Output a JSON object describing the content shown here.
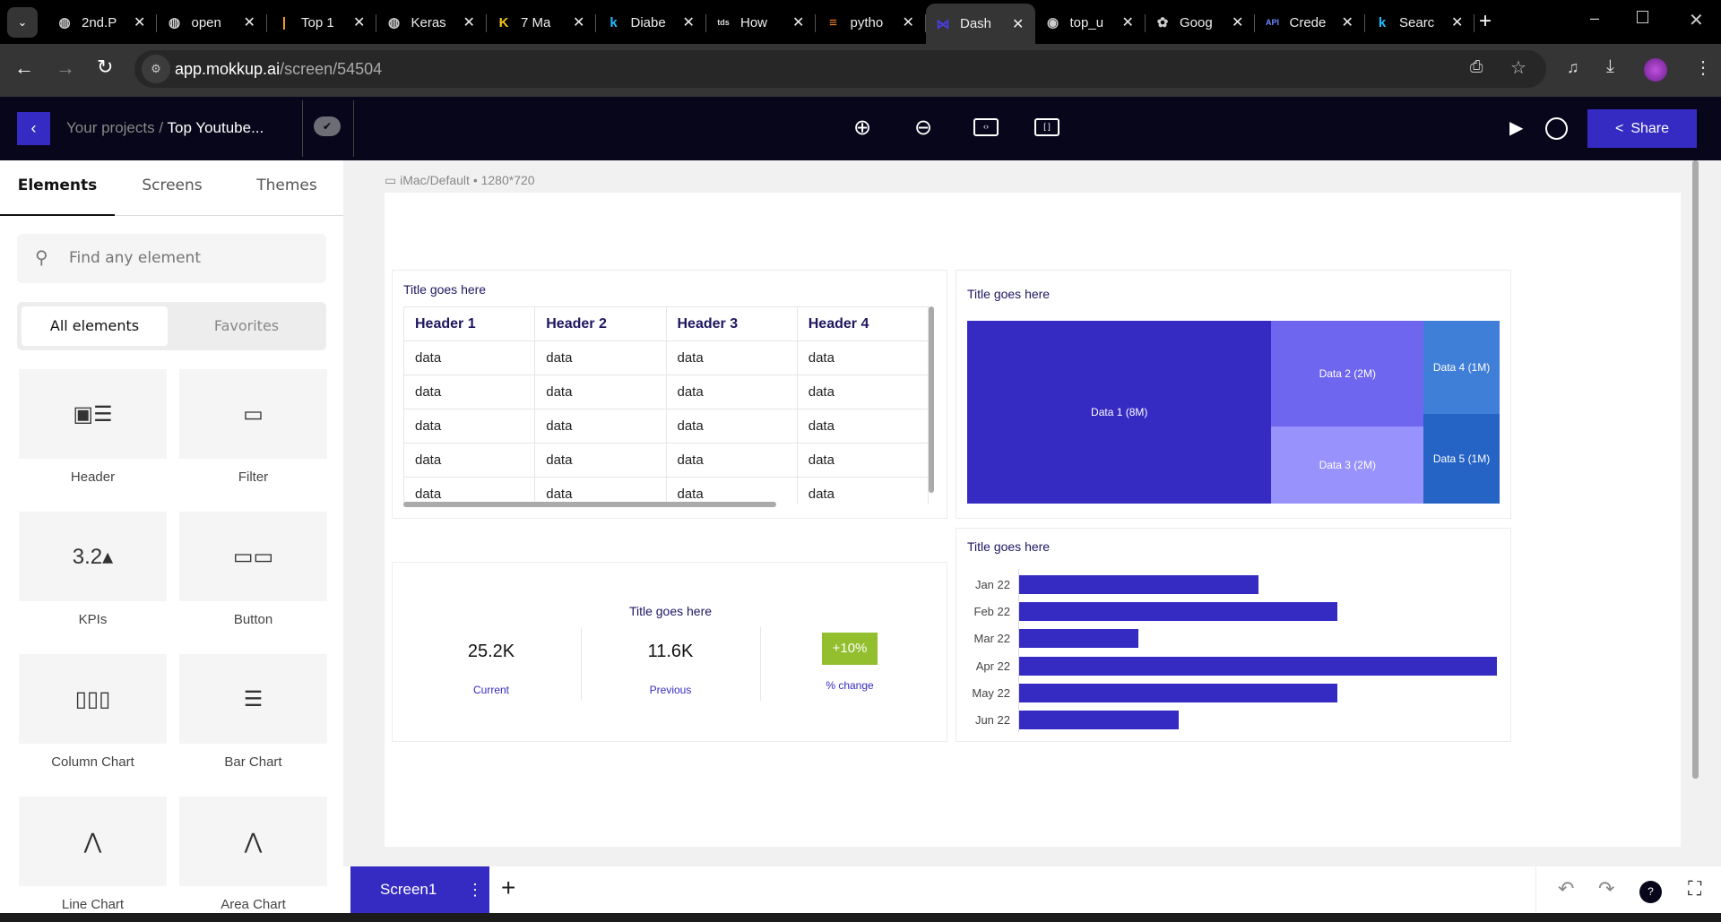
{
  "browser": {
    "tabs": [
      {
        "title": "2nd.P",
        "icon": "globe-icon"
      },
      {
        "title": "open",
        "icon": "globe-icon"
      },
      {
        "title": "Top 1",
        "icon": "bars-icon"
      },
      {
        "title": "Keras",
        "icon": "globe-icon"
      },
      {
        "title": "7 Ma",
        "icon": "k-icon"
      },
      {
        "title": "Diabe",
        "icon": "kaggle-icon"
      },
      {
        "title": "How",
        "icon": "tds-icon"
      },
      {
        "title": "pytho",
        "icon": "stackoverflow-icon"
      },
      {
        "title": "Dash",
        "icon": "mokkup-icon",
        "active": true
      },
      {
        "title": "top_u",
        "icon": "github-icon"
      },
      {
        "title": "Goog",
        "icon": "openai-icon"
      },
      {
        "title": "Crede",
        "icon": "api-icon"
      },
      {
        "title": "Searc",
        "icon": "kaggle-icon"
      }
    ],
    "url_host": "app.mokkup.ai",
    "url_path": "/screen/54504"
  },
  "header": {
    "breadcrumb_root": "Your projects",
    "breadcrumb_sep": " / ",
    "project": "Top Youtube...",
    "share_label": "Share",
    "accent": "#352bc2"
  },
  "sidebar": {
    "tabs": [
      "Elements",
      "Screens",
      "Themes"
    ],
    "search_placeholder": "Find any element",
    "filters": [
      "All elements",
      "Favorites"
    ],
    "elements": [
      "Header",
      "Filter",
      "KPIs",
      "Button",
      "Column Chart",
      "Bar Chart",
      "Line Chart",
      "Area Chart"
    ]
  },
  "canvas": {
    "device_label": "iMac/Default • 1280*720"
  },
  "table_card": {
    "title": "Title goes here",
    "headers": [
      "Header 1",
      "Header 2",
      "Header 3",
      "Header 4"
    ],
    "rows": [
      [
        "data",
        "data",
        "data",
        "data"
      ],
      [
        "data",
        "data",
        "data",
        "data"
      ],
      [
        "data",
        "data",
        "data",
        "data"
      ],
      [
        "data",
        "data",
        "data",
        "data"
      ],
      [
        "data",
        "data",
        "data",
        "data"
      ]
    ]
  },
  "kpi_card": {
    "title": "Title goes here",
    "current": "25.2K",
    "current_label": "Current",
    "previous": "11.6K",
    "previous_label": "Previous",
    "change": "+10%",
    "change_label": "% change",
    "change_color": "#93bf2f"
  },
  "chart_data": [
    {
      "type": "treemap",
      "title": "Title goes here",
      "items": [
        {
          "label": "Data 1 (8M)",
          "value": 8,
          "color": "#352bc2"
        },
        {
          "label": "Data 2 (2M)",
          "value": 2,
          "color": "#6e66ee"
        },
        {
          "label": "Data 3 (2M)",
          "value": 2,
          "color": "#9892fd"
        },
        {
          "label": "Data 4 (1M)",
          "value": 1,
          "color": "#407fd8"
        },
        {
          "label": "Data 5 (1M)",
          "value": 1,
          "color": "#2563c4"
        }
      ]
    },
    {
      "type": "bar",
      "orientation": "horizontal",
      "title": "Title goes here",
      "categories": [
        "Jan 22",
        "Feb 22",
        "Mar 22",
        "Apr 22",
        "May 22",
        "Jun 22"
      ],
      "values": [
        30,
        40,
        15,
        60,
        40,
        20
      ],
      "color": "#352bc2",
      "grid": false
    }
  ],
  "bottom": {
    "screen_tab": "Screen1"
  }
}
